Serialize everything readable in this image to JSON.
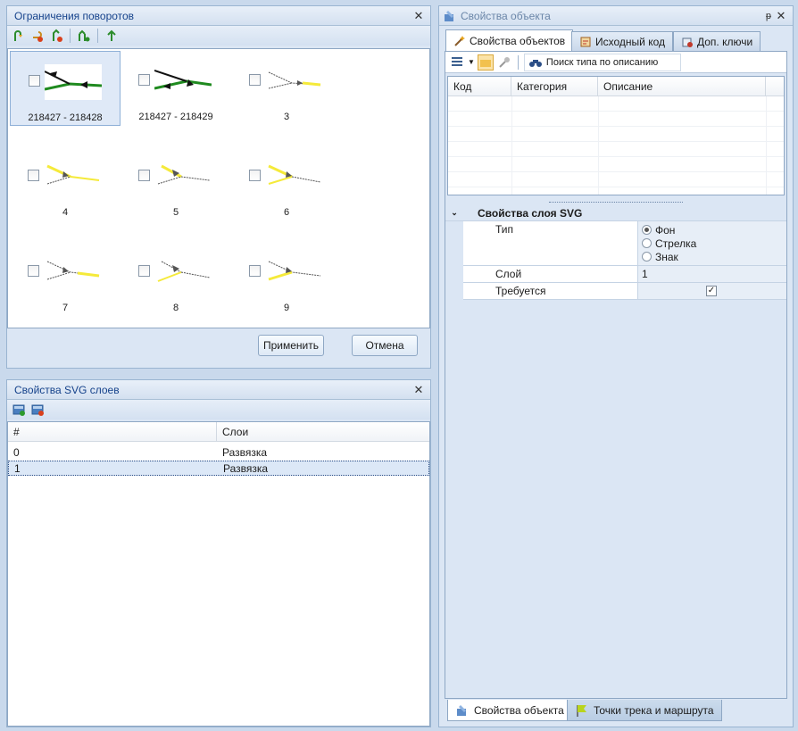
{
  "turn_panel": {
    "title": "Ограничения поворотов",
    "items": [
      {
        "label": "218427 - 218428",
        "style": "green-left"
      },
      {
        "label": "218427 - 218429",
        "style": "green-both"
      },
      {
        "label": "3",
        "style": "y-right"
      },
      {
        "label": "4",
        "style": "y-left"
      },
      {
        "label": "5",
        "style": "y-mid"
      },
      {
        "label": "6",
        "style": "y-right2"
      },
      {
        "label": "7",
        "style": "y-left2"
      },
      {
        "label": "8",
        "style": "y-mid2"
      },
      {
        "label": "9",
        "style": "y-right3"
      }
    ],
    "apply_label": "Применить",
    "cancel_label": "Отмена"
  },
  "svg_layers_panel": {
    "title": "Свойства SVG слоев",
    "columns": [
      "#",
      "Слои"
    ],
    "rows": [
      [
        "0",
        "Развязка"
      ],
      [
        "1",
        "Развязка"
      ]
    ]
  },
  "object_panel": {
    "title": "Свойства объекта",
    "pin": "ᵽ",
    "tabs": [
      "Свойства объектов",
      "Исходный код",
      "Доп. ключи"
    ],
    "search_label": "Поиск типа по описанию",
    "columns": [
      "Код",
      "Категория",
      "Описание"
    ],
    "section_title": "Свойства слоя SVG",
    "props": {
      "type_label": "Тип",
      "type_options": [
        "Фон",
        "Стрелка",
        "Знак"
      ],
      "layer_label": "Слой",
      "layer_value": "1",
      "required_label": "Требуется"
    },
    "bottom_tabs": [
      "Свойства объекта",
      "Точки трека и маршрута"
    ]
  },
  "colors": {
    "accent": "#15428b",
    "road": "#1f8a1f",
    "highlight": "#f5ea3a"
  }
}
